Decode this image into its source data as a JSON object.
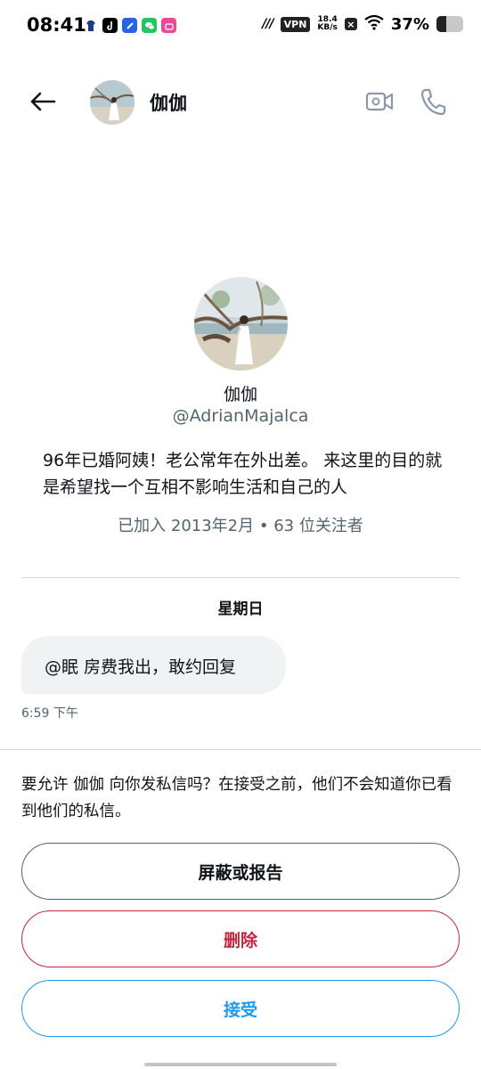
{
  "status_bar": {
    "time": "08:41",
    "vpn": "VPN",
    "speed_value": "18.4",
    "speed_unit": "KB/s",
    "battery_percent_text": "37%",
    "battery_level": 0.37
  },
  "header": {
    "name": "伽伽",
    "back_icon": "arrow-left-icon",
    "video_icon": "video-camera-icon",
    "call_icon": "phone-icon"
  },
  "profile": {
    "name": "伽伽",
    "handle": "@AdrianMajalca",
    "bio": "96年已婚阿姨！老公常年在外出差。 来这里的目的就是希望找一个互相不影响生活和自己的人",
    "meta": "已加入 2013年2月 • 63 位关注者"
  },
  "conversation": {
    "day_label": "星期日",
    "messages": [
      {
        "text": "@眠 房费我出，敢约回复",
        "time": "6:59 下午"
      }
    ]
  },
  "request": {
    "notice": "要允许 伽伽 向你发私信吗？在接受之前，他们不会知道你已看到他们的私信。",
    "block_label": "屏蔽或报告",
    "delete_label": "删除",
    "accept_label": "接受"
  },
  "colors": {
    "accent": "#1d9bf0",
    "danger": "#c4263e",
    "secondary_text": "#536471",
    "bubble_bg": "#eff3f4"
  }
}
